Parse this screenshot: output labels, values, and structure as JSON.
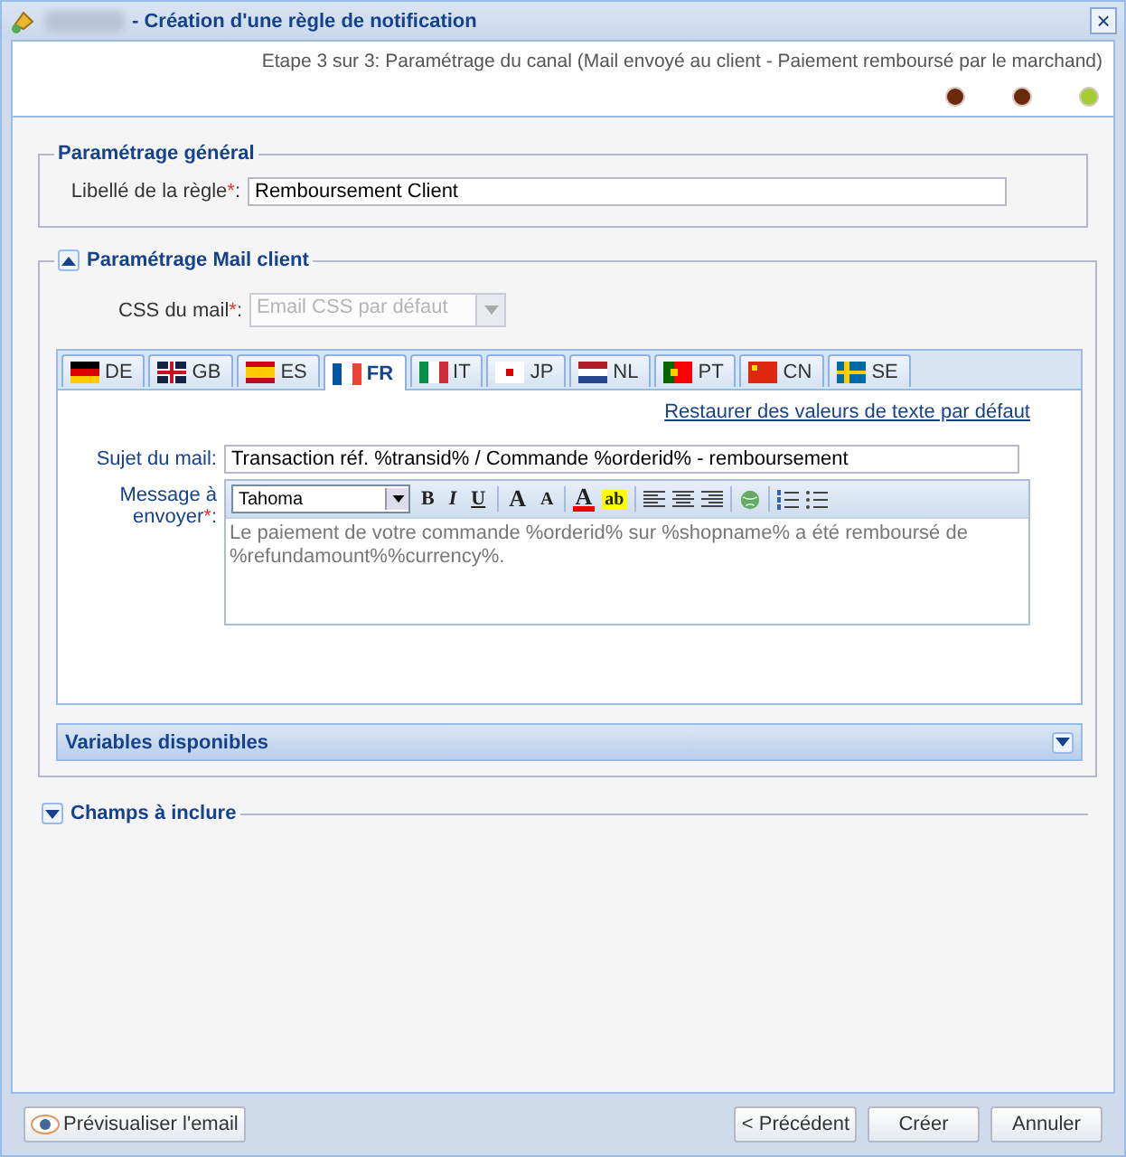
{
  "window": {
    "title": "- Création d'une règle de notification",
    "close": "×"
  },
  "wizard": {
    "step_text": "Etape 3 sur 3: Paramétrage du canal (Mail envoyé au client - Paiement remboursé par le marchand)",
    "steps": [
      {
        "color": "#6b2a0c"
      },
      {
        "color": "#6b2a0c"
      },
      {
        "color": "#a6cc33"
      }
    ]
  },
  "general": {
    "legend": "Paramétrage général",
    "rule_label": "Libellé de la règle",
    "required": "*",
    "colon": ":",
    "rule_value": "Remboursement Client"
  },
  "mail_client": {
    "legend": "Paramétrage Mail client",
    "expanded": true,
    "css_label": "CSS du mail",
    "required": "*",
    "colon": ":",
    "css_value": "Email CSS par défaut",
    "css_disabled": true,
    "tabs": [
      {
        "label": "DE",
        "selected": false
      },
      {
        "label": "GB",
        "selected": false
      },
      {
        "label": "ES",
        "selected": false
      },
      {
        "label": "FR",
        "selected": true
      },
      {
        "label": "IT",
        "selected": false
      },
      {
        "label": "JP",
        "selected": false
      },
      {
        "label": "NL",
        "selected": false
      },
      {
        "label": "PT",
        "selected": false
      },
      {
        "label": "CN",
        "selected": false
      },
      {
        "label": "SE",
        "selected": false
      }
    ],
    "restore_link": "Restaurer des valeurs de texte par défaut",
    "subject_label": "Sujet du mail:",
    "subject_value": "Transaction réf. %transid% / Commande %orderid% - remboursement",
    "message_label": "Message à envoyer",
    "message_required": "*",
    "message_colon": ":",
    "font": "Tahoma",
    "toolbar": [
      {
        "kind": "text",
        "label": "B"
      },
      {
        "kind": "text",
        "label": "I"
      },
      {
        "kind": "text",
        "label": "U"
      },
      {
        "kind": "sep"
      },
      {
        "kind": "text",
        "label": "A"
      },
      {
        "kind": "text",
        "label": "A"
      },
      {
        "kind": "sep"
      },
      {
        "kind": "fontcolor",
        "label": "A"
      },
      {
        "kind": "highlight",
        "label": "ab"
      },
      {
        "kind": "sep"
      },
      {
        "kind": "align-left"
      },
      {
        "kind": "align-center"
      },
      {
        "kind": "align-right"
      },
      {
        "kind": "sep"
      },
      {
        "kind": "link"
      },
      {
        "kind": "sep"
      },
      {
        "kind": "ol"
      },
      {
        "kind": "ul"
      }
    ],
    "message": "Le paiement de votre commande %orderid% sur %shopname% a été remboursé de %refundamount%%currency%.",
    "variables": {
      "label": "Variables disponibles",
      "expanded": false
    }
  },
  "fields_section": {
    "legend": "Champs à inclure",
    "expanded": false
  },
  "footer": {
    "preview": "Prévisualiser l'email",
    "buttons": [
      "< Précédent",
      "Créer",
      "Annuler"
    ]
  }
}
